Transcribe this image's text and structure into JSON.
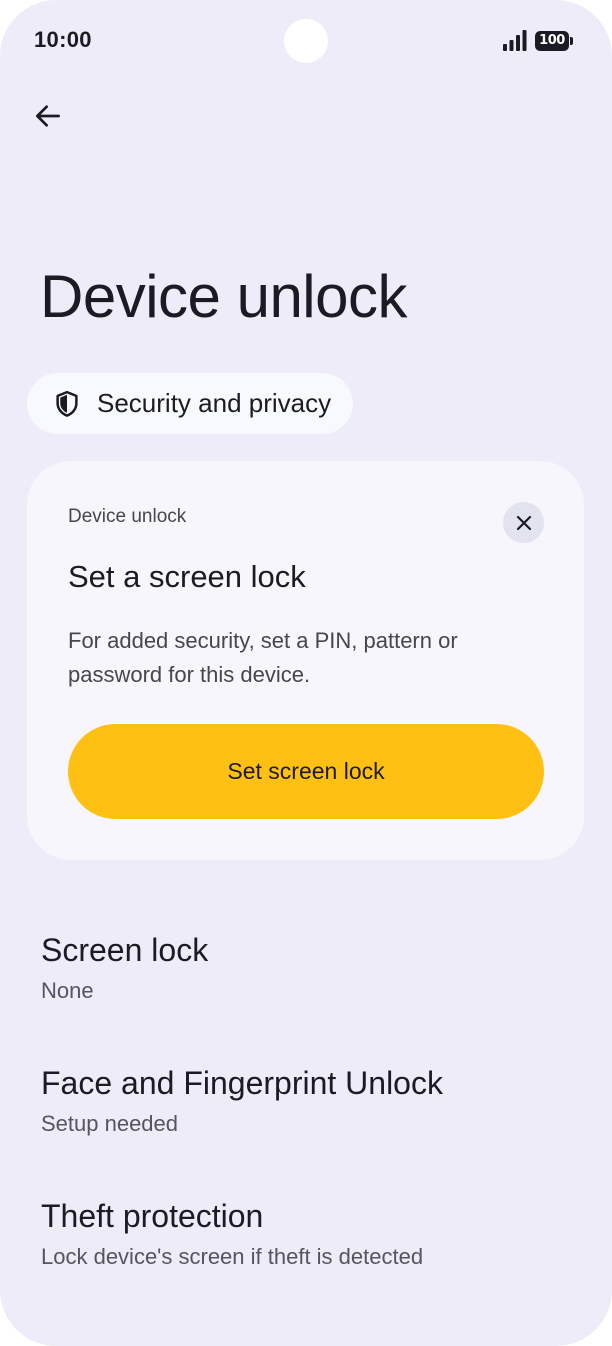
{
  "status_bar": {
    "time": "10:00",
    "battery_level": "100",
    "icons": [
      "signal-icon",
      "battery-icon"
    ]
  },
  "header": {
    "back_icon": "arrow-back-icon",
    "title": "Device unlock"
  },
  "breadcrumb": {
    "icon": "shield-icon",
    "label": "Security and privacy"
  },
  "card": {
    "kicker": "Device unlock",
    "title": "Set a screen lock",
    "body": "For added security, set a PIN, pattern or password for this device.",
    "cta_label": "Set screen lock",
    "close_icon": "close-icon",
    "cta_color": "#ffc014"
  },
  "settings": {
    "items": [
      {
        "title": "Screen lock",
        "summary": "None"
      },
      {
        "title": "Face and Fingerprint Unlock",
        "summary": "Setup needed"
      },
      {
        "title": "Theft protection",
        "summary": "Lock device's screen if theft is detected"
      }
    ]
  },
  "colors": {
    "background": "#edecf8",
    "card": "#f7f6fd",
    "accent": "#ffc014",
    "text": "#1c1b23"
  }
}
